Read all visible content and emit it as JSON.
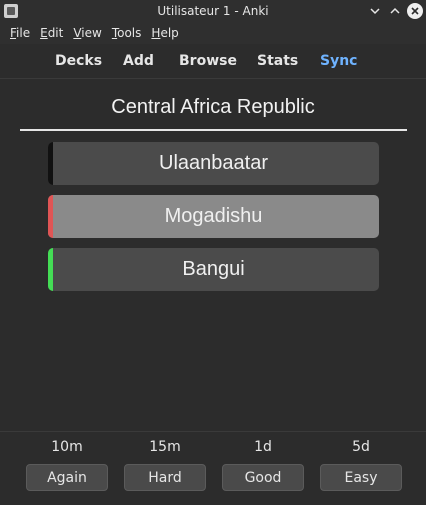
{
  "window": {
    "title": "Utilisateur 1 - Anki",
    "icons": {
      "app": "anki-app-icon",
      "minimize": "chevron-down-icon",
      "maximize": "chevron-up-icon",
      "close": "close-icon"
    }
  },
  "menu": {
    "items": [
      {
        "label": "File"
      },
      {
        "label": "Edit"
      },
      {
        "label": "View"
      },
      {
        "label": "Tools"
      },
      {
        "label": "Help"
      }
    ]
  },
  "toolbar": {
    "items": [
      {
        "label": "Decks"
      },
      {
        "label": "Add"
      },
      {
        "label": "Browse"
      },
      {
        "label": "Stats"
      },
      {
        "label": "Sync"
      }
    ],
    "sync_color": "#6fb3ff"
  },
  "card": {
    "question": "Central Africa Republic",
    "answers": [
      {
        "label": "Ulaanbaatar",
        "edge_color": "#111111",
        "background": "#4b4b4b"
      },
      {
        "label": "Mogadishu",
        "edge_color": "#e05555",
        "background": "#8a8a8a"
      },
      {
        "label": "Bangui",
        "edge_color": "#44dd55",
        "background": "#4b4b4b"
      }
    ]
  },
  "answer_buttons": [
    {
      "interval": "10m",
      "label": "Again"
    },
    {
      "interval": "15m",
      "label": "Hard"
    },
    {
      "interval": "1d",
      "label": "Good"
    },
    {
      "interval": "5d",
      "label": "Easy"
    }
  ]
}
